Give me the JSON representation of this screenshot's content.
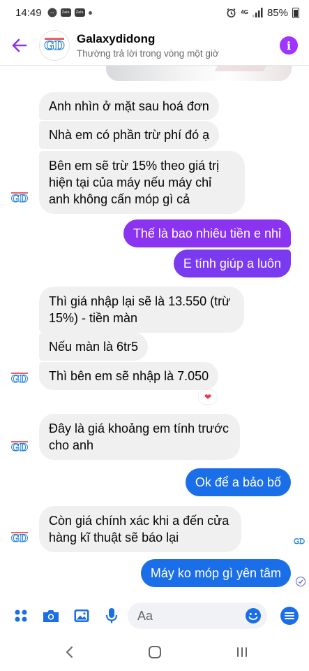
{
  "status_bar": {
    "time": "14:49",
    "notif_chip_1": "Zalo",
    "notif_chip_2": "Zalo",
    "network": "4G",
    "battery": "85%"
  },
  "header": {
    "title": "Galaxydidong",
    "subtitle": "Thường trả lời trong vòng một giờ",
    "avatar_text": "GD"
  },
  "messages": [
    {
      "id": "m1",
      "side": "in",
      "text": "Anh nhìn ở mặt sau hoá đơn"
    },
    {
      "id": "m2",
      "side": "in",
      "text": "Nhà em có phần trừ phí đó ạ"
    },
    {
      "id": "m3",
      "side": "in",
      "text": "Bên em sẽ trừ 15% theo giá trị hiện tại của máy nếu máy chỉ anh không cấn móp gì cả"
    },
    {
      "id": "m4",
      "side": "out",
      "text": "Thế là bao nhiêu tiền e nhỉ"
    },
    {
      "id": "m5",
      "side": "out",
      "text": "E tính giúp a luôn"
    },
    {
      "id": "m6",
      "side": "in",
      "text": "Thì giá nhập lại sẽ là 13.550 (trừ 15%) - tiền màn"
    },
    {
      "id": "m7",
      "side": "in",
      "text": "Nếu màn là 6tr5"
    },
    {
      "id": "m8",
      "side": "in",
      "text": "Thì bên em sẽ nhập là 7.050",
      "reaction": "❤"
    },
    {
      "id": "m9",
      "side": "in",
      "text": "Đây là giá khoảng em tính trước cho anh"
    },
    {
      "id": "m10",
      "side": "out",
      "text": "Ok để a bảo bố"
    },
    {
      "id": "m11",
      "side": "in",
      "text": "Còn giá chính xác khi a đến cửa hàng kĩ thuật sẽ báo lại"
    },
    {
      "id": "m12",
      "side": "out",
      "text": "Máy ko móp gì yên tâm"
    }
  ],
  "composer": {
    "placeholder": "Aa"
  },
  "colors": {
    "accent_purple": "#a033ff",
    "bubble_purple": "#8a33f0",
    "bubble_blue": "#1a6ee8",
    "incoming_bg": "#f0f0f0",
    "tool_blue": "#1a6ee8"
  },
  "icons": {
    "back": "back-arrow-icon",
    "info": "info-icon",
    "apps": "apps-icon",
    "camera": "camera-icon",
    "gallery": "gallery-icon",
    "mic": "mic-icon",
    "emoji": "emoji-icon",
    "menu": "menu-icon",
    "nav_back": "nav-back-icon",
    "nav_home": "nav-home-icon",
    "nav_recents": "nav-recents-icon"
  }
}
